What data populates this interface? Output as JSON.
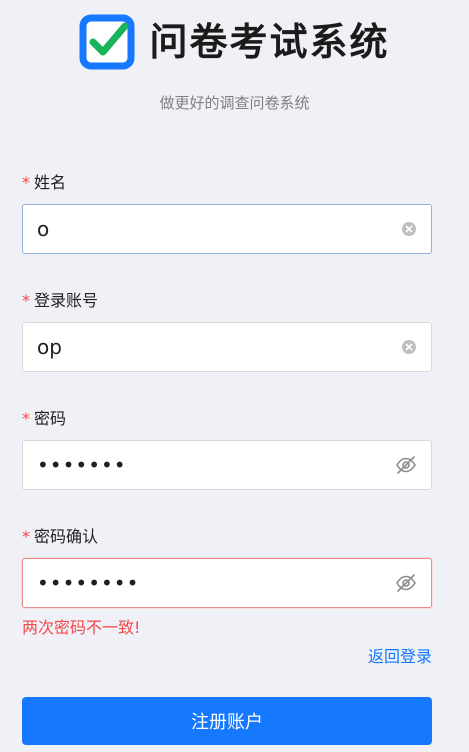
{
  "header": {
    "app_title": "问卷考试系统",
    "subtitle": "做更好的调查问卷系统",
    "logo_icon": "checkbox-check-icon",
    "logo_color": "#1677ff",
    "check_color": "#19b35a"
  },
  "form": {
    "required_mark": "*",
    "name": {
      "label": "姓名",
      "value": "o"
    },
    "account": {
      "label": "登录账号",
      "value": "op"
    },
    "password": {
      "label": "密码",
      "value": "•••••••"
    },
    "confirm": {
      "label": "密码确认",
      "value": "••••••••",
      "error": "两次密码不一致!"
    }
  },
  "links": {
    "back_to_login": "返回登录"
  },
  "buttons": {
    "register": "注册账户"
  },
  "colors": {
    "primary": "#1677ff",
    "error": "#f5484a",
    "background": "#eff1f6"
  }
}
